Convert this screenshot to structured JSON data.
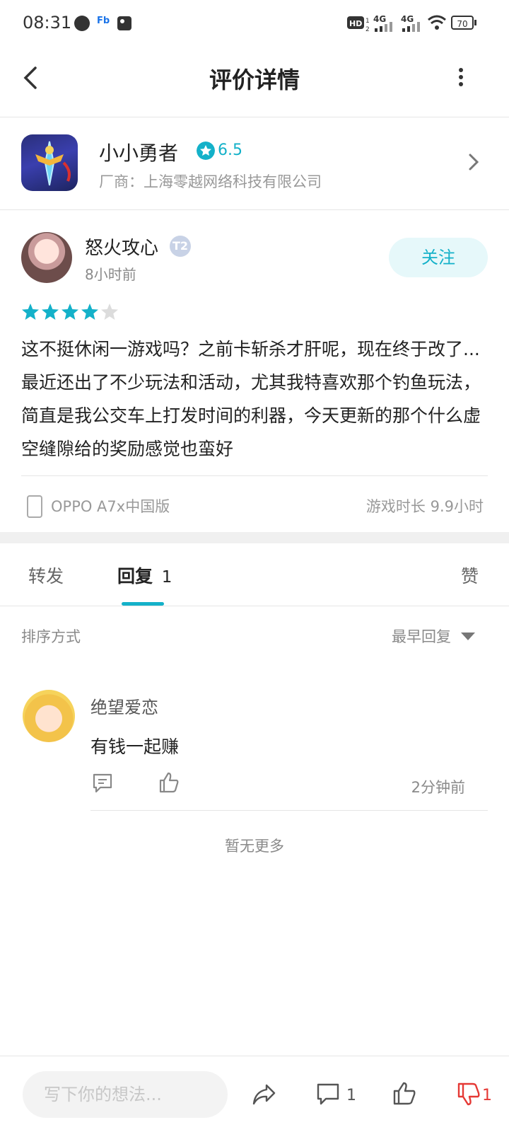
{
  "status_bar": {
    "time": "08:31",
    "battery": "70",
    "network1": "4G",
    "network2": "4G"
  },
  "header": {
    "title": "评价详情"
  },
  "game": {
    "name": "小小勇者",
    "rating": "6.5",
    "vendor": "厂商：上海零越网络科技有限公司"
  },
  "review": {
    "user_name": "怒火攻心",
    "level_badge": "T2",
    "time_ago": "8小时前",
    "follow_label": "关注",
    "stars_filled": 4,
    "stars_total": 5,
    "text": "这不挺休闲一游戏吗？之前卡斩杀才肝呢，现在终于改了...最近还出了不少玩法和活动，尤其我特喜欢那个钓鱼玩法，简直是我公交车上打发时间的利器，今天更新的那个什么虚空缝隙给的奖励感觉也蛮好",
    "device": "OPPO A7x中国版",
    "playtime": "游戏时长 9.9小时"
  },
  "tabs": {
    "forward": "转发",
    "reply": "回复",
    "reply_count": "1",
    "like": "赞"
  },
  "sort": {
    "label": "排序方式",
    "value": "最早回复"
  },
  "replies": [
    {
      "user": "绝望爱恋",
      "text": "有钱一起赚",
      "time": "2分钟前"
    }
  ],
  "no_more": "暂无更多",
  "bottom_bar": {
    "input_placeholder": "写下你的想法...",
    "comment_count": "1",
    "dislike_count": "1"
  },
  "colors": {
    "accent": "#14b1c9",
    "dislike": "#e53935"
  }
}
